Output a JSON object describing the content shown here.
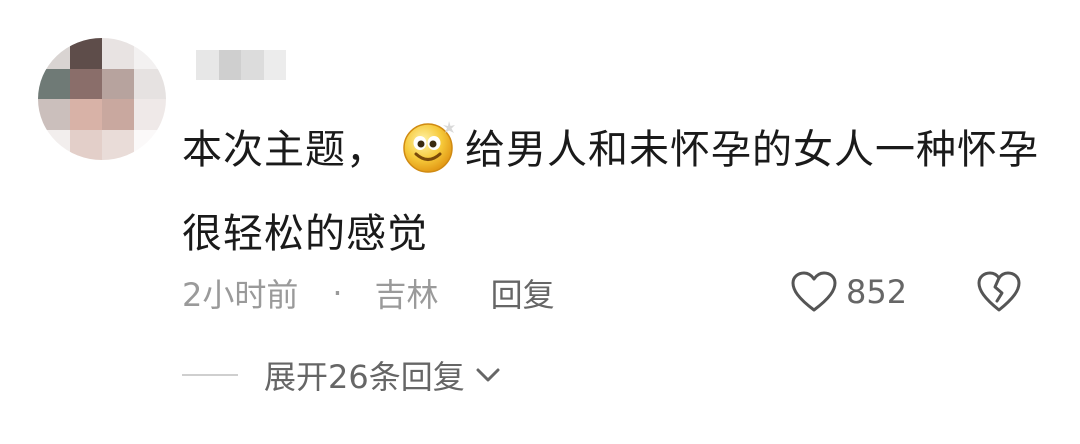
{
  "comment": {
    "text_part1": "本次主题，",
    "emoji_icon": "smiley-sparkle-icon",
    "text_part2": "给男人和未怀孕的女人一种怀孕很轻松的感觉"
  },
  "meta": {
    "time": "2小时前",
    "separator": "·",
    "location": "吉林",
    "reply_label": "回复"
  },
  "actions": {
    "like_count": "852",
    "like_icon": "heart-outline-icon",
    "dislike_icon": "broken-heart-icon"
  },
  "expand": {
    "label": "展开26条回复",
    "icon": "chevron-down-icon"
  },
  "colors": {
    "text_primary": "#1a1a1a",
    "text_secondary": "#9a9a9a",
    "action_gray": "#666666"
  }
}
